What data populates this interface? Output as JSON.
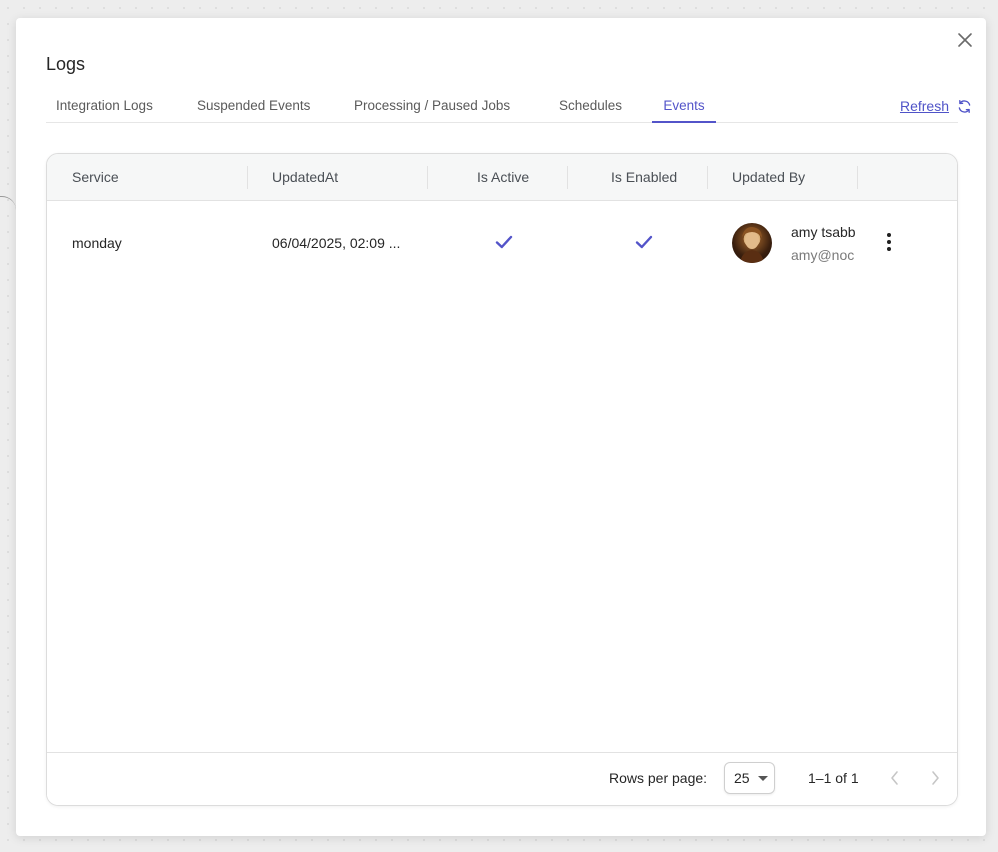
{
  "dialog": {
    "title": "Logs"
  },
  "tabs": [
    {
      "label": "Integration Logs",
      "active": false
    },
    {
      "label": "Suspended Events",
      "active": false
    },
    {
      "label": "Processing / Paused Jobs",
      "active": false
    },
    {
      "label": "Schedules",
      "active": false
    },
    {
      "label": "Events",
      "active": true
    }
  ],
  "refresh": {
    "label": "Refresh",
    "icon": "refresh-icon"
  },
  "table": {
    "columns": [
      "Service",
      "UpdatedAt",
      "Is Active",
      "Is Enabled",
      "Updated By"
    ],
    "rows": [
      {
        "service": "monday",
        "updated_at": "06/04/2025, 02:09 ...",
        "is_active": true,
        "is_enabled": true,
        "updated_by": {
          "name": "amy tsabb",
          "email": "amy@noc"
        }
      }
    ]
  },
  "pagination": {
    "rows_per_page_label": "Rows per page:",
    "rows_per_page": "25",
    "range": "1–1 of 1"
  },
  "colors": {
    "accent": "#5354c9",
    "link": "#4f53c8",
    "header_bg": "#f6f7f7"
  }
}
